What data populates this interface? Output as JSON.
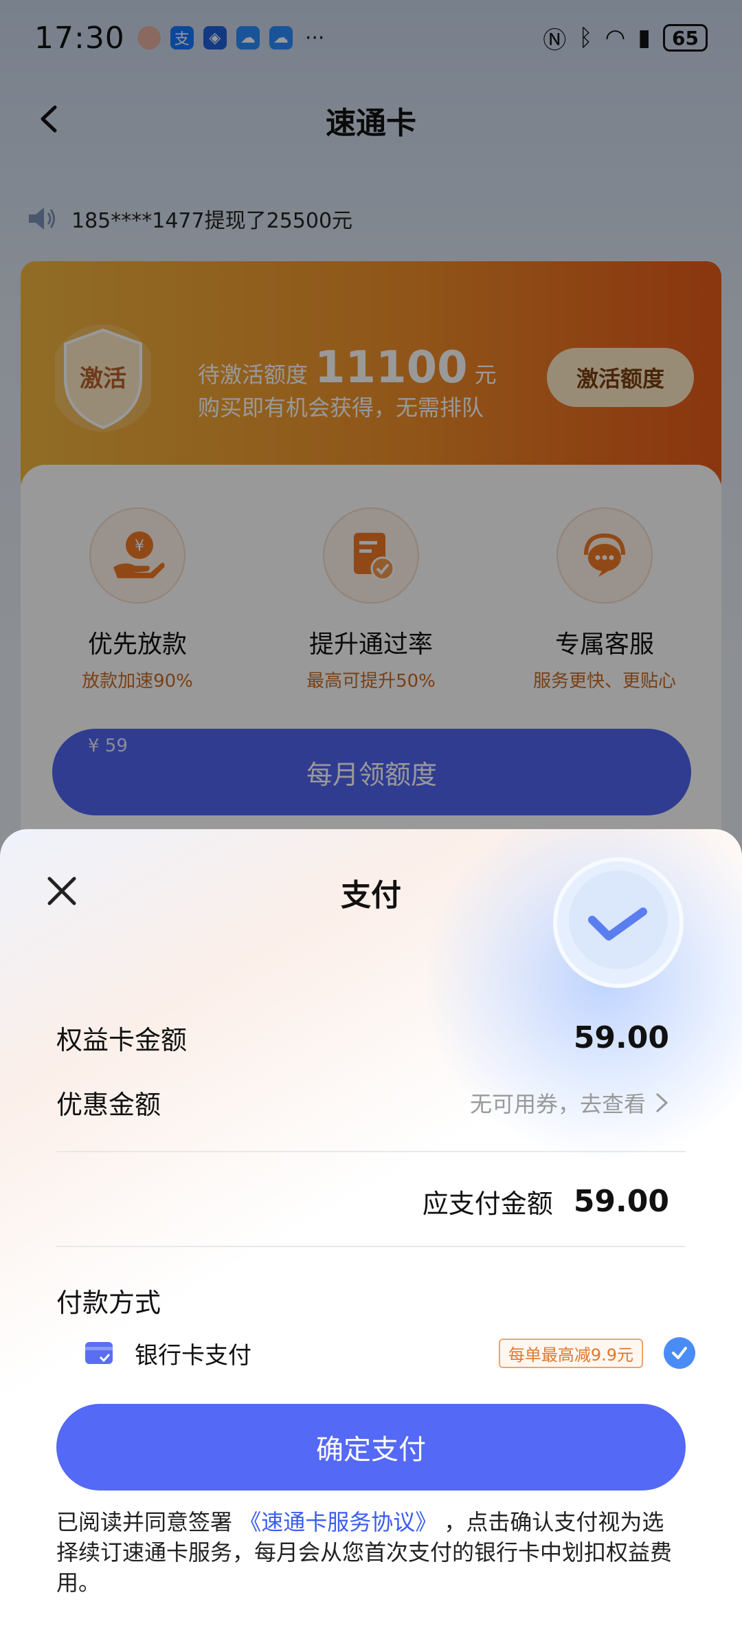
{
  "status_bar": {
    "time": "17:30",
    "notif_icons": [
      "avatar-icon",
      "alipay-icon",
      "bank-icon",
      "cloud-icon",
      "cloud-icon"
    ],
    "more": "···",
    "battery": "65"
  },
  "nav": {
    "title": "速通卡"
  },
  "marquee": {
    "text": "185****1477提现了25500元"
  },
  "promo": {
    "shield_text": "激活",
    "label": "待激活额度",
    "amount": "11100",
    "unit": "元",
    "subtitle": "购买即有机会获得，无需排队",
    "button": "激活额度"
  },
  "benefits": [
    {
      "title": "优先放款",
      "sub": "放款加速90%"
    },
    {
      "title": "提升通过率",
      "sub": "最高可提升50%"
    },
    {
      "title": "专属客服",
      "sub": "服务更快、更贴心"
    }
  ],
  "monthly": {
    "price": "¥ 59",
    "label": "每月领额度"
  },
  "sheet": {
    "title": "支付",
    "card_amount_label": "权益卡金额",
    "card_amount_value": "59.00",
    "discount_label": "优惠金额",
    "discount_value": "无可用券，去查看",
    "total_label": "应支付金额",
    "total_value": "59.00",
    "payment_title": "付款方式",
    "payment_method": "银行卡支付",
    "payment_tag": "每单最高减9.9元",
    "confirm": "确定支付",
    "agreement_prefix": "已阅读并同意签署",
    "agreement_link": "《速通卡服务协议》",
    "agreement_suffix": "，点击确认支付视为选择续订速通卡服务，每月会从您首次支付的银行卡中划扣权益费用。"
  },
  "colors": {
    "primary": "#5469f5",
    "promo_orange": "#f08f2a",
    "link": "#3a5df0",
    "tag_orange": "#e2772d"
  }
}
